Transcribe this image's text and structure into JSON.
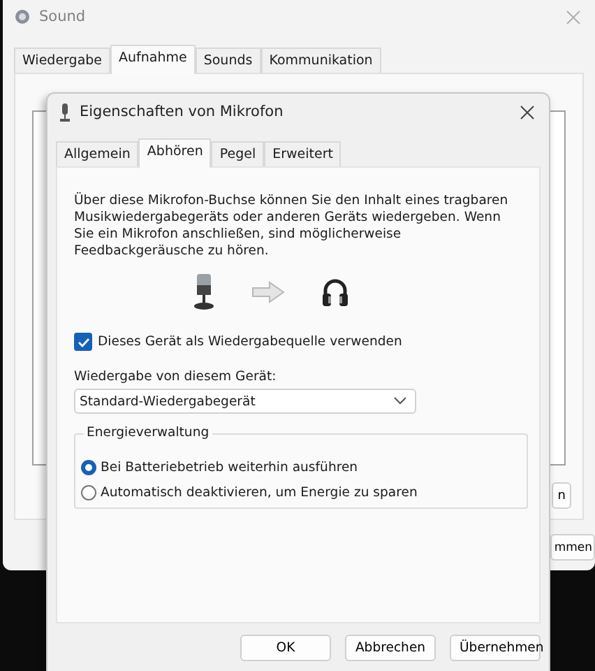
{
  "background_window": {
    "title": "Sound",
    "tabs": [
      {
        "label": "Wiedergabe",
        "selected": false
      },
      {
        "label": "Aufnahme",
        "selected": true
      },
      {
        "label": "Sounds",
        "selected": false
      },
      {
        "label": "Kommunikation",
        "selected": false
      }
    ],
    "side_button": "n",
    "bottom_button": "mmen"
  },
  "dialog": {
    "title": "Eigenschaften von Mikrofon",
    "tabs": [
      {
        "label": "Allgemein",
        "selected": false
      },
      {
        "label": "Abhören",
        "selected": true
      },
      {
        "label": "Pegel",
        "selected": false
      },
      {
        "label": "Erweitert",
        "selected": false
      }
    ],
    "description": "Über diese Mikrofon-Buchse können Sie den Inhalt eines tragbaren Musikwiedergabegeräts oder anderen Geräts wiedergeben. Wenn Sie ein Mikrofon anschließen, sind möglicherweise Feedbackgeräusche zu hören.",
    "checkbox": {
      "label": "Dieses Gerät als Wiedergabequelle verwenden",
      "checked": true
    },
    "playback_label": "Wiedergabe von diesem Gerät:",
    "dropdown": {
      "value": "Standard-Wiedergabegerät"
    },
    "group": {
      "title": "Energieverwaltung",
      "options": [
        {
          "label": "Bei Batteriebetrieb weiterhin ausführen",
          "selected": true
        },
        {
          "label": "Automatisch deaktivieren, um Energie zu sparen",
          "selected": false
        }
      ]
    },
    "buttons": [
      "OK",
      "Abbrechen",
      "Übernehmen"
    ]
  }
}
